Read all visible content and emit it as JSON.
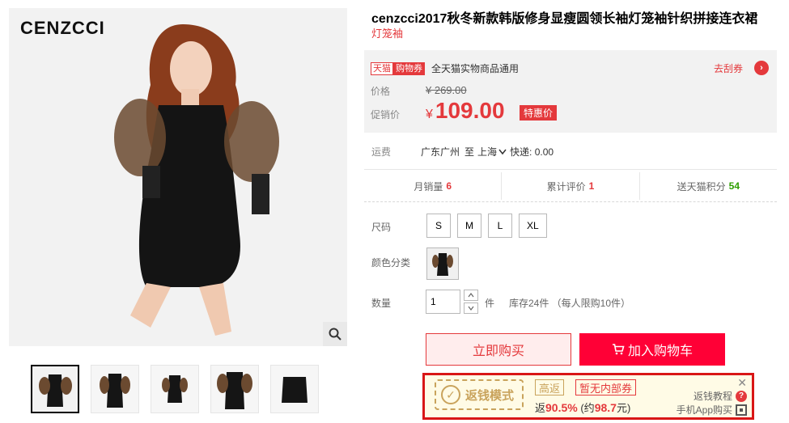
{
  "gallery": {
    "brand_logo": "CENZCCI",
    "thumbnail_count": 5
  },
  "product": {
    "title": "cenzcci2017秋冬新款韩版修身显瘦圆领长袖灯笼袖针织拼接连衣裙",
    "subtitle": "灯笼袖"
  },
  "coupon": {
    "tag_tmall": "天猫",
    "tag_coupon": "购物券",
    "text": "全天猫实物商品通用",
    "link": "去刮券",
    "link_icon": "chevron-right-icon"
  },
  "price": {
    "price_label": "价格",
    "original": "¥ 269.00",
    "promo_label": "促销价",
    "currency": "¥",
    "promo": "109.00",
    "promo_tag": "特惠价"
  },
  "shipping": {
    "label": "运费",
    "from": "广东广州",
    "to_word": "至",
    "to": "上海",
    "fee": "快递: 0.00"
  },
  "stats": [
    {
      "label": "月销量",
      "value": "6"
    },
    {
      "label": "累计评价",
      "value": "1"
    },
    {
      "label": "送天猫积分",
      "value": "54"
    }
  ],
  "options": {
    "size_label": "尺码",
    "sizes": [
      "S",
      "M",
      "L",
      "XL"
    ],
    "color_label": "颜色分类",
    "qty_label": "数量",
    "qty_value": "1",
    "unit": "件",
    "stock": "库存24件 （每人限购10件）"
  },
  "actions": {
    "buy_now": "立即购买",
    "add_to_cart": "加入购物车"
  },
  "rebate": {
    "stamp": "返钱模式",
    "tag_high": "高返",
    "tag_none": "暂无内部券",
    "prefix": "返",
    "rate": "90.5%",
    "approx_prefix": "(约",
    "amount": "98.7",
    "approx_suffix": "元)",
    "tutorial": "返钱教程",
    "app_buy": "手机App购买"
  },
  "colors": {
    "accent": "#e4393c",
    "cart": "#ff0036",
    "gold": "#c9a35c",
    "green": "#2e9e00"
  }
}
